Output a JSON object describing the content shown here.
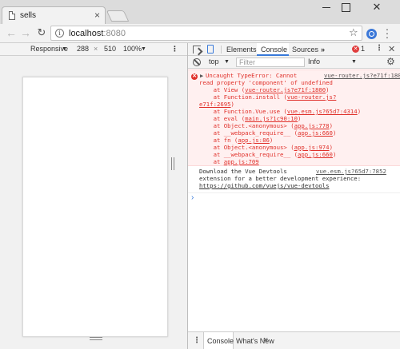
{
  "window": {
    "tab_title": "sells",
    "tab_close": "×",
    "minimize": "",
    "maximize": "",
    "close": "✕"
  },
  "address": {
    "host": "localhost",
    "port": ":8080"
  },
  "device_toolbar": {
    "mode": "Responsive",
    "width": "288",
    "times": "×",
    "height": "510",
    "zoom": "100%",
    "caret": "▼",
    "more": "⋮"
  },
  "devtools": {
    "tabs": [
      "Elements",
      "Console",
      "Sources"
    ],
    "active_tab": "Console",
    "more_tabs": "»",
    "error_badge": "✕",
    "error_count": "1",
    "menu": "⋮",
    "close": "✕",
    "context": "top",
    "context_caret": "▼",
    "filter_placeholder": "Filter",
    "levels": "Info",
    "levels_caret": "▼",
    "settings": "⚙"
  },
  "console": {
    "error": {
      "icon": "✕",
      "toggle": "▶",
      "message_l1": "Uncaught TypeError: Cannot",
      "message_l2": "read property 'component' of undefined",
      "source": "vue-router.js?e71f:1800",
      "stack": [
        {
          "prefix": "    at View (",
          "link": "vue-router.js?e71f:1800",
          "suffix": ")"
        },
        {
          "prefix": "    at Function.install (",
          "link": "vue-router.js?",
          "suffix": ""
        },
        {
          "prefix": "",
          "link": "e71f:2695",
          "suffix": ")"
        },
        {
          "prefix": "    at Function.Vue.use (",
          "link": "vue.esm.js?65d7:4314",
          "suffix": ")"
        },
        {
          "prefix": "    at eval (",
          "link": "main.js?1c90:10",
          "suffix": ")"
        },
        {
          "prefix": "    at Object.<anonymous> (",
          "link": "app.js:778",
          "suffix": ")"
        },
        {
          "prefix": "    at __webpack_require__ (",
          "link": "app.js:660",
          "suffix": ")"
        },
        {
          "prefix": "    at fn (",
          "link": "app.js:86",
          "suffix": ")"
        },
        {
          "prefix": "    at Object.<anonymous> (",
          "link": "app.js:974",
          "suffix": ")"
        },
        {
          "prefix": "    at __webpack_require__ (",
          "link": "app.js:660",
          "suffix": ")"
        },
        {
          "prefix": "    at ",
          "link": "app.js:709",
          "suffix": ""
        }
      ]
    },
    "info": {
      "l1": "Download the Vue Devtools",
      "l2": "extension for a better development experience:",
      "link": "https://github.com/vuejs/vue-devtools",
      "source": "vue.esm.js?65d7:7852"
    },
    "prompt": "›"
  },
  "drawer": {
    "menu": "⋮",
    "tabs": [
      "Console",
      "What's New"
    ],
    "close": "×"
  },
  "colors": {
    "error_text": "#e0302a",
    "error_bg": "#fff0f0",
    "accent_blue": "#3879d9"
  }
}
